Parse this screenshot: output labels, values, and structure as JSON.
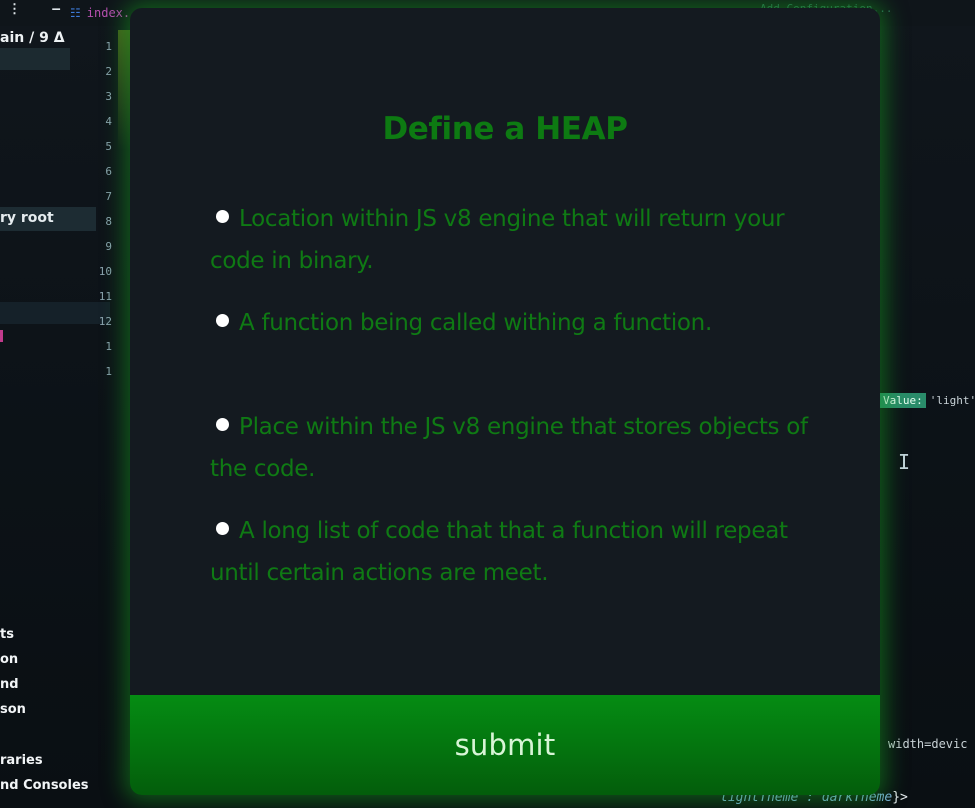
{
  "background": {
    "branch_label": "ain / 9 Δ",
    "file_tab_label": "index.",
    "right_tab_label": "Add Configuration...",
    "line_numbers": [
      "1",
      "2",
      "3",
      "4",
      "5",
      "6",
      "7",
      "8",
      "9",
      "10",
      "11",
      "12",
      "1",
      "1"
    ],
    "selected_sidebar_item": "ry root",
    "sidebar_items_upper": [
      "ts",
      "on",
      "nd",
      "son"
    ],
    "sidebar_items_lower": [
      "raries",
      "nd Consoles"
    ],
    "value_tag_key": "Value:",
    "value_tag_value": "'light'",
    "width_text": "width=devic",
    "bottom_code": "lightTheme : darkTheme",
    "bottom_code_suffix": "}>"
  },
  "modal": {
    "title": "Define a HEAP",
    "options": [
      {
        "label": "Location within JS v8 engine that will return your code in binary."
      },
      {
        "label": "A function being called withing a function."
      },
      {
        "label": "Place within the JS v8 engine that stores objects of the code."
      },
      {
        "label": "A long list of code that that a function will repeat until certain actions are meet."
      }
    ],
    "submit_label": "submit"
  },
  "colors": {
    "accent_green": "#0f7a14",
    "submit_bg": "#04760f",
    "modal_bg": "#141a20",
    "glow": "#14961e"
  }
}
